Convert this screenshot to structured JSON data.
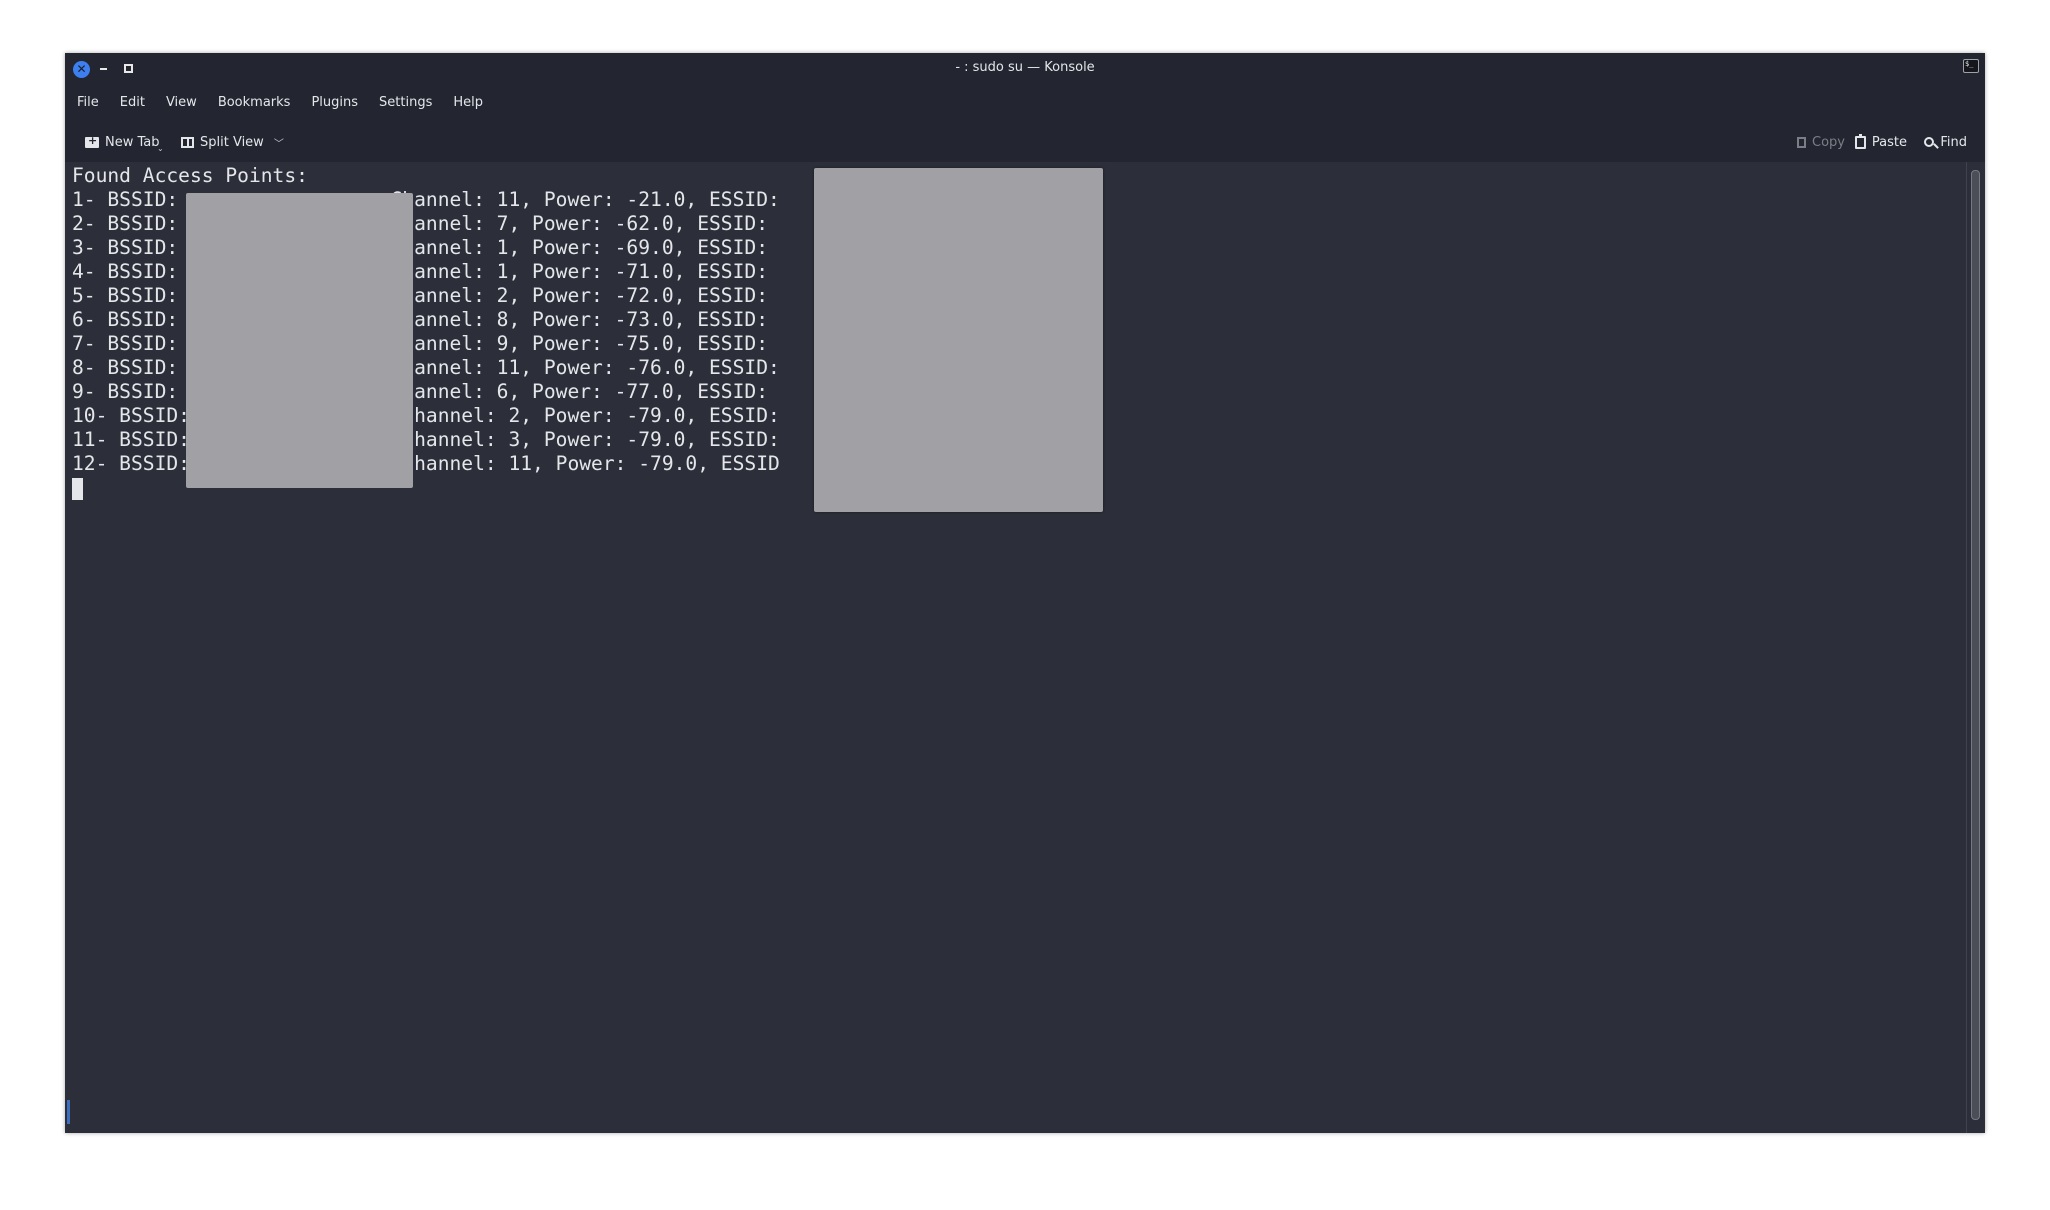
{
  "window": {
    "title": "- : sudo su — Konsole",
    "close_glyph": "✕",
    "terminal_icon_glyph": "$_"
  },
  "menubar": [
    "File",
    "Edit",
    "View",
    "Bookmarks",
    "Plugins",
    "Settings",
    "Help"
  ],
  "toolbar": {
    "new_tab": "New Tab",
    "split_view": "Split View",
    "copy": "Copy",
    "paste": "Paste",
    "find": "Find",
    "dropdown_glyph": "⌄",
    "chevron_glyph": "﹀"
  },
  "terminal": {
    "heading": "Found Access Points:",
    "lines": [
      "1- BSSID:                  Channel: 11, Power: -21.0, ESSID:",
      "2- BSSID:                  Channel: 7, Power: -62.0, ESSID:",
      "3- BSSID:                  Channel: 1, Power: -69.0, ESSID:",
      "4- BSSID:                  Channel: 1, Power: -71.0, ESSID:",
      "5- BSSID:                  Channel: 2, Power: -72.0, ESSID:",
      "6- BSSID:                  Channel: 8, Power: -73.0, ESSID:",
      "7- BSSID:                  Channel: 9, Power: -75.0, ESSID:",
      "8- BSSID:                  Channel: 11, Power: -76.0, ESSID:",
      "9- BSSID:                  Channel: 6, Power: -77.0, ESSID:",
      "10- BSSID:                  Channel: 2, Power: -79.0, ESSID:",
      "11- BSSID:                  Channel: 3, Power: -79.0, ESSID:",
      "12- BSSID:                  Channel: 11, Power: -79.0, ESSID"
    ],
    "access_points": [
      {
        "index": 1,
        "channel": 11,
        "power": -21.0
      },
      {
        "index": 2,
        "channel": 7,
        "power": -62.0
      },
      {
        "index": 3,
        "channel": 1,
        "power": -69.0
      },
      {
        "index": 4,
        "channel": 1,
        "power": -71.0
      },
      {
        "index": 5,
        "channel": 2,
        "power": -72.0
      },
      {
        "index": 6,
        "channel": 8,
        "power": -73.0
      },
      {
        "index": 7,
        "channel": 9,
        "power": -75.0
      },
      {
        "index": 8,
        "channel": 11,
        "power": -76.0
      },
      {
        "index": 9,
        "channel": 6,
        "power": -77.0
      },
      {
        "index": 10,
        "channel": 2,
        "power": -79.0
      },
      {
        "index": 11,
        "channel": 3,
        "power": -79.0
      },
      {
        "index": 12,
        "channel": 11,
        "power": -79.0
      }
    ]
  },
  "colors": {
    "accent": "#3d7ef0",
    "terminal_bg": "#2c2f39",
    "chrome_bg": "#232630",
    "redaction": "#a1a0a5"
  }
}
